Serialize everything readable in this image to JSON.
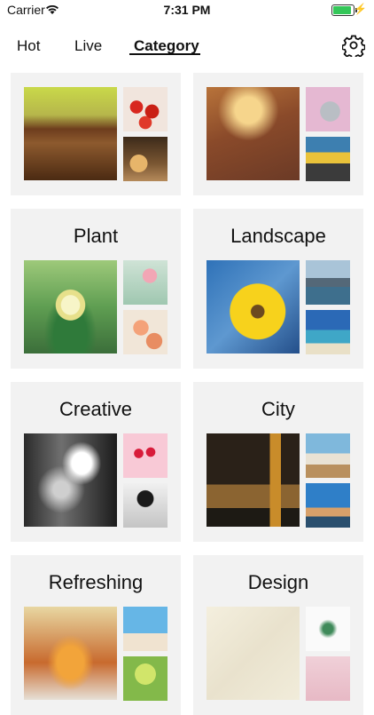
{
  "status_bar": {
    "carrier": "Carrier",
    "time": "7:31 PM"
  },
  "tabs": [
    {
      "label": "Hot",
      "active": false
    },
    {
      "label": "Live",
      "active": false
    },
    {
      "label": "Category",
      "active": true
    }
  ],
  "categories": [
    {
      "title": ""
    },
    {
      "title": ""
    },
    {
      "title": "Plant"
    },
    {
      "title": "Landscape"
    },
    {
      "title": "Creative"
    },
    {
      "title": "City"
    },
    {
      "title": "Refreshing"
    },
    {
      "title": "Design"
    }
  ],
  "icons": {
    "settings": "gear-icon",
    "wifi": "wifi-icon",
    "battery": "battery-icon"
  },
  "colors": {
    "card_bg": "#f2f2f2",
    "battery": "#34c759"
  }
}
